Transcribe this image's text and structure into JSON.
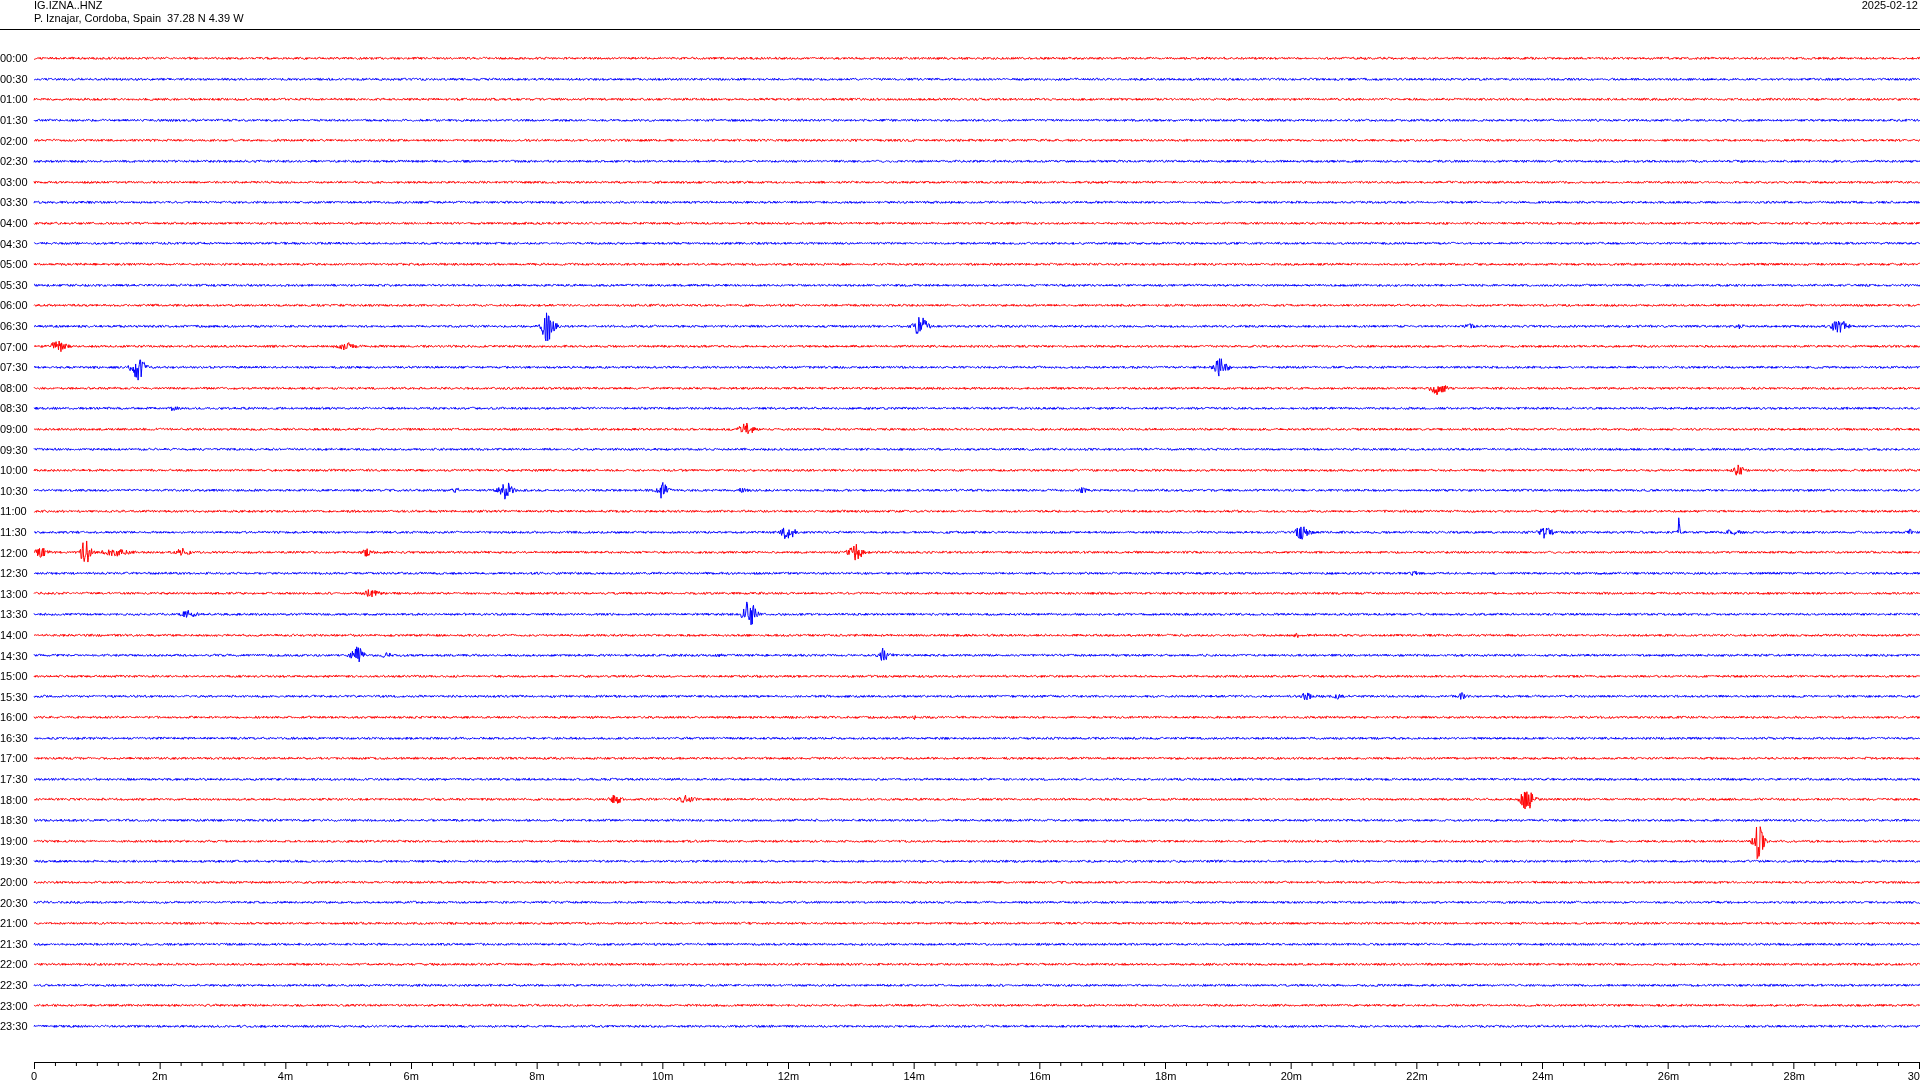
{
  "header": {
    "station": "IG.IZNA..HNZ",
    "location": "P. Iznajar, Cordoba, Spain  37.28 N 4.39 W",
    "date": "2025-02-12"
  },
  "rows": [
    {
      "label": "00:00",
      "color": "#ff0000"
    },
    {
      "label": "00:30",
      "color": "#0000ff"
    },
    {
      "label": "01:00",
      "color": "#ff0000"
    },
    {
      "label": "01:30",
      "color": "#0000ff"
    },
    {
      "label": "02:00",
      "color": "#ff0000"
    },
    {
      "label": "02:30",
      "color": "#0000ff"
    },
    {
      "label": "03:00",
      "color": "#ff0000"
    },
    {
      "label": "03:30",
      "color": "#0000ff"
    },
    {
      "label": "04:00",
      "color": "#ff0000"
    },
    {
      "label": "04:30",
      "color": "#0000ff"
    },
    {
      "label": "05:00",
      "color": "#ff0000"
    },
    {
      "label": "05:30",
      "color": "#0000ff"
    },
    {
      "label": "06:00",
      "color": "#ff0000"
    },
    {
      "label": "06:30",
      "color": "#0000ff"
    },
    {
      "label": "07:00",
      "color": "#ff0000"
    },
    {
      "label": "07:30",
      "color": "#0000ff"
    },
    {
      "label": "08:00",
      "color": "#ff0000"
    },
    {
      "label": "08:30",
      "color": "#0000ff"
    },
    {
      "label": "09:00",
      "color": "#ff0000"
    },
    {
      "label": "09:30",
      "color": "#0000ff"
    },
    {
      "label": "10:00",
      "color": "#ff0000"
    },
    {
      "label": "10:30",
      "color": "#0000ff"
    },
    {
      "label": "11:00",
      "color": "#ff0000"
    },
    {
      "label": "11:30",
      "color": "#0000ff"
    },
    {
      "label": "12:00",
      "color": "#ff0000"
    },
    {
      "label": "12:30",
      "color": "#0000ff"
    },
    {
      "label": "13:00",
      "color": "#ff0000"
    },
    {
      "label": "13:30",
      "color": "#0000ff"
    },
    {
      "label": "14:00",
      "color": "#ff0000"
    },
    {
      "label": "14:30",
      "color": "#0000ff"
    },
    {
      "label": "15:00",
      "color": "#ff0000"
    },
    {
      "label": "15:30",
      "color": "#0000ff"
    },
    {
      "label": "16:00",
      "color": "#ff0000"
    },
    {
      "label": "16:30",
      "color": "#0000ff"
    },
    {
      "label": "17:00",
      "color": "#ff0000"
    },
    {
      "label": "17:30",
      "color": "#0000ff"
    },
    {
      "label": "18:00",
      "color": "#ff0000"
    },
    {
      "label": "18:30",
      "color": "#0000ff"
    },
    {
      "label": "19:00",
      "color": "#ff0000"
    },
    {
      "label": "19:30",
      "color": "#0000ff"
    },
    {
      "label": "20:00",
      "color": "#ff0000"
    },
    {
      "label": "20:30",
      "color": "#0000ff"
    },
    {
      "label": "21:00",
      "color": "#ff0000"
    },
    {
      "label": "21:30",
      "color": "#0000ff"
    },
    {
      "label": "22:00",
      "color": "#ff0000"
    },
    {
      "label": "22:30",
      "color": "#0000ff"
    },
    {
      "label": "23:00",
      "color": "#ff0000"
    },
    {
      "label": "23:30",
      "color": "#0000ff"
    }
  ],
  "axis": {
    "ticks": [
      "0",
      "2m",
      "4m",
      "6m",
      "8m",
      "10m",
      "12m",
      "14m",
      "16m",
      "18m",
      "20m",
      "22m",
      "24m",
      "26m",
      "28m",
      "30"
    ]
  }
}
